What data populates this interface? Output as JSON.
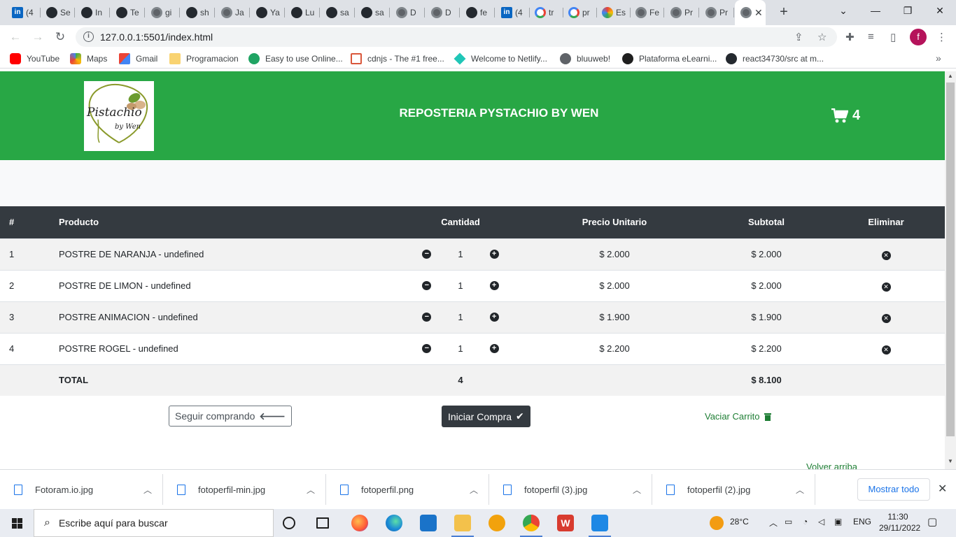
{
  "browser": {
    "tabs": [
      {
        "favicon": "linkedin-icon",
        "label": "(4"
      },
      {
        "favicon": "github-icon",
        "label": "Se"
      },
      {
        "favicon": "github-icon",
        "label": "In"
      },
      {
        "favicon": "github-icon",
        "label": "Te"
      },
      {
        "favicon": "globe-icon",
        "label": "gi"
      },
      {
        "favicon": "github-icon",
        "label": "sh"
      },
      {
        "favicon": "globe-icon",
        "label": "Ja"
      },
      {
        "favicon": "github-icon",
        "label": "Ya"
      },
      {
        "favicon": "github-icon",
        "label": "Lu"
      },
      {
        "favicon": "github-icon",
        "label": "sa"
      },
      {
        "favicon": "github-icon",
        "label": "sa"
      },
      {
        "favicon": "globe-icon",
        "label": "D"
      },
      {
        "favicon": "globe-icon",
        "label": "D"
      },
      {
        "favicon": "github-icon",
        "label": "fe"
      },
      {
        "favicon": "linkedin-icon",
        "label": "(4"
      },
      {
        "favicon": "google-icon",
        "label": "tr"
      },
      {
        "favicon": "google-icon",
        "label": "pr"
      },
      {
        "favicon": "color-circle-icon",
        "label": "Es"
      },
      {
        "favicon": "globe-icon",
        "label": "Fe"
      },
      {
        "favicon": "globe-icon",
        "label": "Pr"
      },
      {
        "favicon": "globe-icon",
        "label": "Pr"
      }
    ],
    "url": "127.0.0.1:5501/index.html",
    "profile_initial": "f",
    "bookmarks": [
      {
        "icon": "youtube-icon",
        "label": "YouTube"
      },
      {
        "icon": "maps-icon",
        "label": "Maps"
      },
      {
        "icon": "gmail-icon",
        "label": "Gmail"
      },
      {
        "icon": "folder-icon",
        "label": "Programacion"
      },
      {
        "icon": "s-icon",
        "label": "Easy to use Online..."
      },
      {
        "icon": "code-icon",
        "label": "cdnjs - The #1 free..."
      },
      {
        "icon": "netlify-icon",
        "label": "Welcome to Netlify..."
      },
      {
        "icon": "globe-icon",
        "label": "bluuweb!"
      },
      {
        "icon": "elearning-icon",
        "label": "Plataforma eLearni..."
      },
      {
        "icon": "github-icon",
        "label": "react34730/src at m..."
      }
    ]
  },
  "page": {
    "site_title": "REPOSTERIA PYSTACHIO BY WEN",
    "cart_count": "4",
    "logo_text_main": "Pistachio",
    "logo_text_sub": "by Wen",
    "table": {
      "headers": [
        "#",
        "Producto",
        "Cantidad",
        "Precio Unitario",
        "Subtotal",
        "Eliminar"
      ],
      "rows": [
        {
          "num": "1",
          "product": "POSTRE DE NARANJA - undefined",
          "qty": "1",
          "unit_price": "$ 2.000",
          "subtotal": "$ 2.000"
        },
        {
          "num": "2",
          "product": "POSTRE DE LIMON - undefined",
          "qty": "1",
          "unit_price": "$ 2.000",
          "subtotal": "$ 2.000"
        },
        {
          "num": "3",
          "product": "POSTRE ANIMACION - undefined",
          "qty": "1",
          "unit_price": "$ 1.900",
          "subtotal": "$ 1.900"
        },
        {
          "num": "4",
          "product": "POSTRE ROGEL - undefined",
          "qty": "1",
          "unit_price": "$ 2.200",
          "subtotal": "$ 2.200"
        }
      ],
      "total_label": "TOTAL",
      "total_qty": "4",
      "total_amount": "$ 8.100"
    },
    "buttons": {
      "continue": "Seguir comprando",
      "checkout": "Iniciar Compra",
      "empty": "Vaciar Carrito"
    },
    "back_to_top": "Volver arriba"
  },
  "downloads": {
    "items": [
      "Fotoram.io.jpg",
      "fotoperfil-min.jpg",
      "fotoperfil.png",
      "fotoperfil (3).jpg",
      "fotoperfil (2).jpg"
    ],
    "show_all": "Mostrar todo"
  },
  "taskbar": {
    "search_placeholder": "Escribe aquí para buscar",
    "weather": "28°C",
    "language": "ENG",
    "time": "11:30",
    "date": "29/11/2022"
  },
  "colors": {
    "header_green": "#28a745",
    "table_header": "#343a40",
    "link_green": "#1e7e34"
  }
}
